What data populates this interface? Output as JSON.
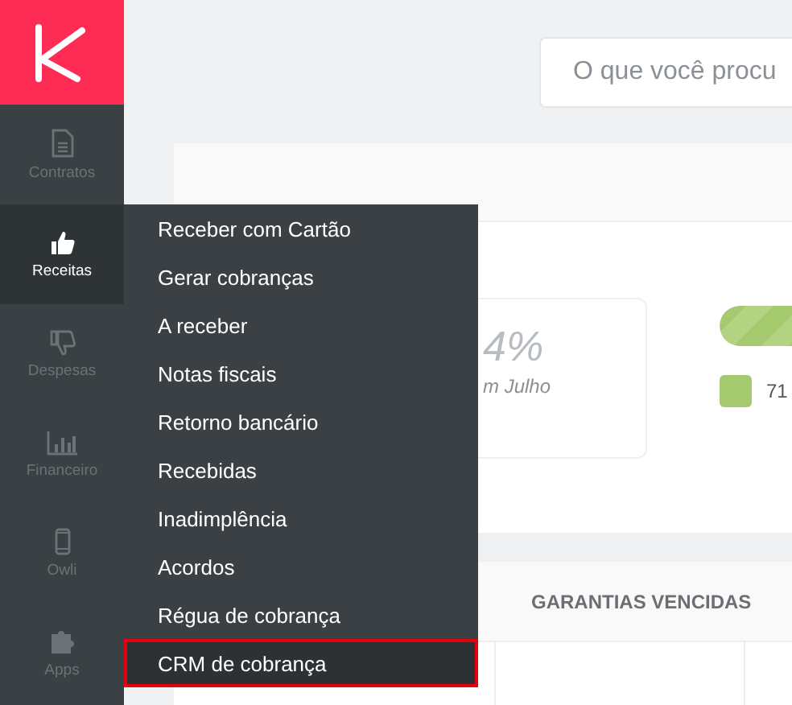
{
  "logo": {
    "kind": "k-mark"
  },
  "nav": [
    {
      "label": "Contratos",
      "selected": false
    },
    {
      "label": "Receitas",
      "selected": true
    },
    {
      "label": "Despesas",
      "selected": false
    },
    {
      "label": "Financeiro",
      "selected": false
    },
    {
      "label": "Owli",
      "selected": false
    },
    {
      "label": "Apps",
      "selected": false
    }
  ],
  "search": {
    "placeholder": "O que você procu"
  },
  "stats": {
    "value": "4%",
    "caption": "m Julho"
  },
  "progress": {
    "level": 1
  },
  "legend": {
    "value": "71",
    "color": "#a5c96e"
  },
  "tabs": [
    {
      "label": "GARANTIAS VENCIDAS"
    }
  ],
  "menu": [
    {
      "label": "Receber com Cartão",
      "selected": false
    },
    {
      "label": "Gerar cobranças",
      "selected": false
    },
    {
      "label": "A receber",
      "selected": false
    },
    {
      "label": "Notas fiscais",
      "selected": false
    },
    {
      "label": "Retorno bancário",
      "selected": false
    },
    {
      "label": "Recebidas",
      "selected": false
    },
    {
      "label": "Inadimplência",
      "selected": false
    },
    {
      "label": "Acordos",
      "selected": false
    },
    {
      "label": "Régua de cobrança",
      "selected": false
    },
    {
      "label": "CRM de cobrança",
      "selected": true
    }
  ]
}
